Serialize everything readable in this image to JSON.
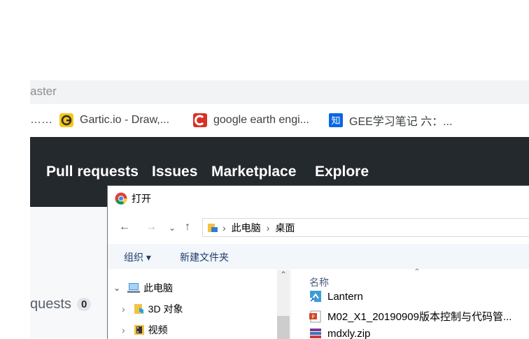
{
  "browser": {
    "url_fragment": "aster",
    "bookmarks": [
      {
        "label": "……",
        "icon": "truncated-bookmark"
      },
      {
        "label": "Gartic.io - Draw,...",
        "icon": "gartic-icon"
      },
      {
        "label": "google earth engi...",
        "icon": "google-earth-engine-icon"
      },
      {
        "label": "GEE学习笔记 六：...",
        "icon": "zhihu-icon"
      }
    ]
  },
  "github": {
    "nav": [
      "Pull requests",
      "Issues",
      "Marketplace",
      "Explore"
    ],
    "requests_label": "quests",
    "requests_count": "0",
    "header_color": "#24292e"
  },
  "dialog": {
    "title": "打开",
    "breadcrumb": [
      "此电脑",
      "桌面"
    ],
    "toolbar": {
      "organize": "组织 ▾",
      "new_folder": "新建文件夹"
    },
    "tree": [
      {
        "label": "此电脑",
        "expanded": true,
        "icon": "computer-icon"
      },
      {
        "label": "3D 对象",
        "expanded": false,
        "icon": "3d-objects-icon"
      },
      {
        "label": "视频",
        "expanded": false,
        "icon": "video-folder-icon"
      }
    ],
    "column_header": "名称",
    "files": [
      {
        "name": "Lantern",
        "icon": "shortcut-icon"
      },
      {
        "name": "M02_X1_20190909版本控制与代码管...",
        "icon": "pdf-icon"
      },
      {
        "name": "mdxly.zip",
        "icon": "zip-icon"
      }
    ]
  }
}
